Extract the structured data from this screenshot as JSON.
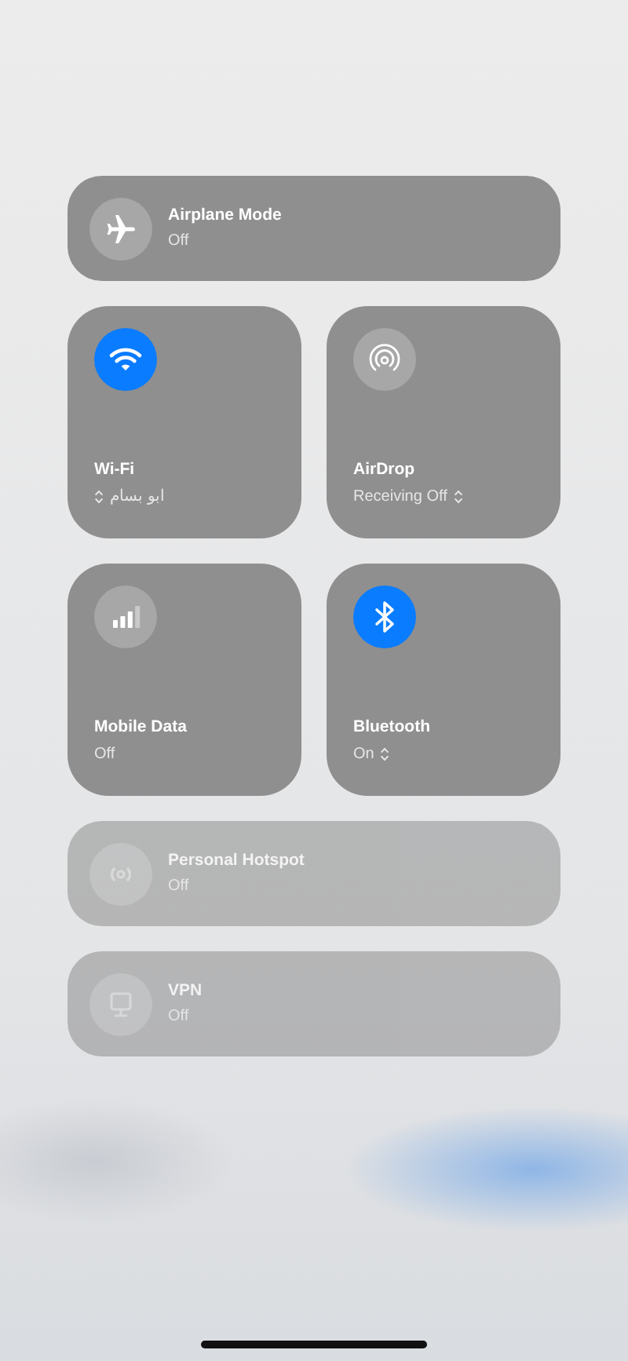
{
  "rows_top": [
    {
      "kind": "airplane",
      "label": "Airplane Mode",
      "status": "Off",
      "on": false,
      "disabled": false
    }
  ],
  "tiles": [
    {
      "kind": "wifi",
      "label": "Wi-Fi",
      "status": "ابو بسام",
      "on": true,
      "chevron": true
    },
    {
      "kind": "airdrop",
      "label": "AirDrop",
      "status": "Receiving Off",
      "on": false,
      "chevron": true
    },
    {
      "kind": "cellular",
      "label": "Mobile Data",
      "status": "Off",
      "on": false,
      "chevron": false
    },
    {
      "kind": "bluetooth",
      "label": "Bluetooth",
      "status": "On",
      "on": true,
      "chevron": true
    }
  ],
  "rows_bottom": [
    {
      "kind": "hotspot",
      "label": "Personal Hotspot",
      "status": "Off",
      "on": false,
      "disabled": true
    },
    {
      "kind": "vpn",
      "label": "VPN",
      "status": "Off",
      "on": false,
      "disabled": true
    }
  ]
}
